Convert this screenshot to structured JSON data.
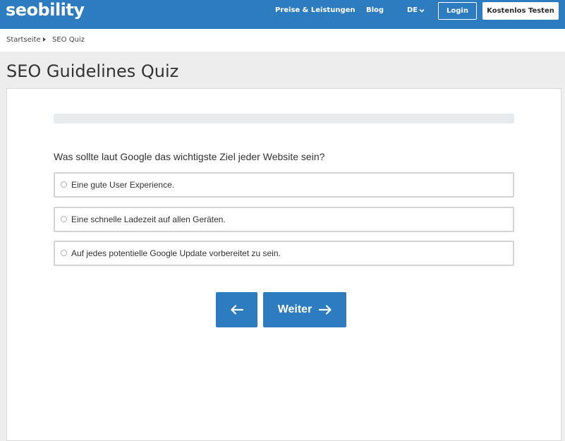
{
  "header": {
    "logo": "seobility",
    "nav": {
      "services": "Preise & Leistungen",
      "blog": "Blog",
      "language": "DE"
    },
    "login_label": "Login",
    "cta_label": "Kostenlos Testen"
  },
  "breadcrumb": {
    "home": "Startseite",
    "current": "SEO Quiz"
  },
  "page": {
    "title": "SEO Guidelines Quiz"
  },
  "quiz": {
    "progress_percent": 0,
    "question": "Was sollte laut Google das wichtigste Ziel jeder Website sein?",
    "options": [
      {
        "label": "Eine gute User Experience."
      },
      {
        "label": "Eine schnelle Ladezeit auf allen Geräten."
      },
      {
        "label": "Auf jedes potentielle Google Update vorbereitet zu sein."
      }
    ],
    "next_label": "Weiter"
  },
  "colors": {
    "brand": "#2d7cbf",
    "background": "#ededed",
    "progress_track": "#e8ebee"
  },
  "icons": {
    "back": "arrow-left-icon",
    "next": "arrow-right-icon",
    "language": "chevron-down-icon",
    "breadcrumb_separator": "caret-right-icon",
    "option": "radio-icon"
  }
}
